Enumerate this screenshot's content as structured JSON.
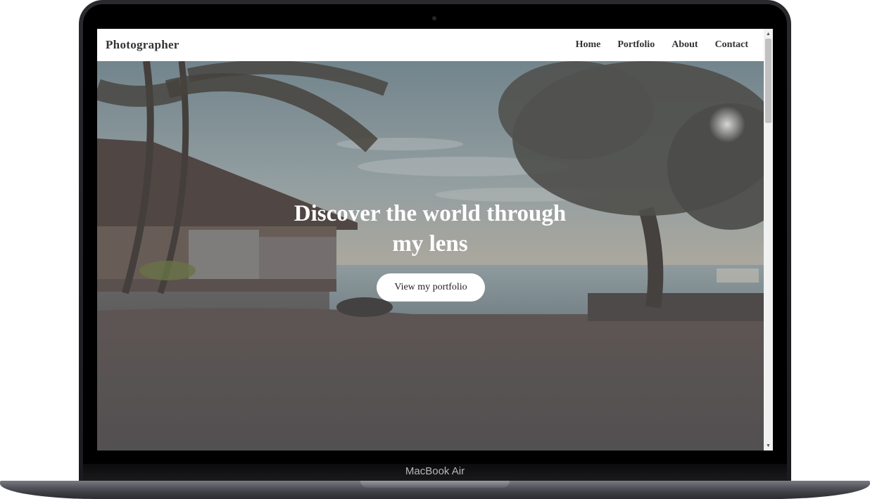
{
  "device": {
    "brand_label": "MacBook Air"
  },
  "site": {
    "logo": "Photographer",
    "nav": [
      {
        "label": "Home"
      },
      {
        "label": "Portfolio"
      },
      {
        "label": "About"
      },
      {
        "label": "Contact"
      }
    ],
    "hero": {
      "title_line1": "Discover the world through",
      "title_line2": "my lens",
      "cta_label": "View my portfolio"
    }
  },
  "scrollbar": {
    "up_icon": "▲",
    "down_icon": "▼"
  },
  "colors": {
    "nav_bg": "#ffffff",
    "nav_text": "#333333",
    "cta_bg": "#ffffff",
    "hero_text": "#ffffff"
  }
}
